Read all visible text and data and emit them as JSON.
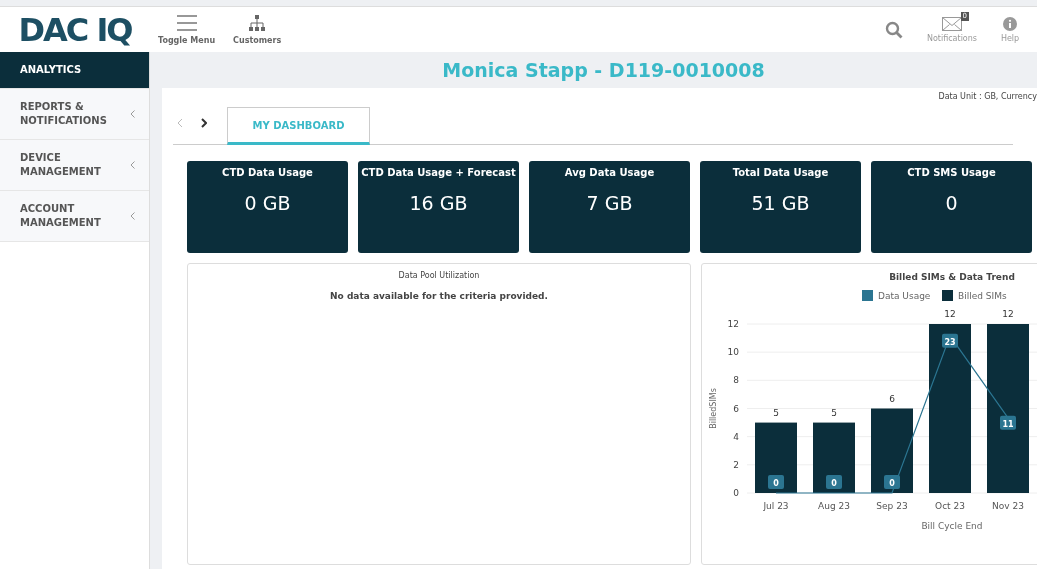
{
  "header": {
    "logo": "DAC IQ",
    "tools": [
      {
        "label": "Toggle Menu",
        "kind": "menu"
      },
      {
        "label": "Customers",
        "kind": "hierarchy"
      }
    ],
    "actions": [
      {
        "kind": "search"
      },
      {
        "kind": "mail",
        "label": "Notifications",
        "badge": "0"
      },
      {
        "kind": "info",
        "label": "Help"
      }
    ]
  },
  "sidebar": {
    "items": [
      {
        "label": "ANALYTICS",
        "selected": true,
        "has_submenu": false
      },
      {
        "label": "REPORTS & NOTIFICATIONS",
        "selected": false,
        "has_submenu": true
      },
      {
        "label": "DEVICE MANAGEMENT",
        "selected": false,
        "has_submenu": true
      },
      {
        "label": "ACCOUNT MANAGEMENT",
        "selected": false,
        "has_submenu": true
      }
    ]
  },
  "page_title": "Monica Stapp - D119-0010008",
  "data_unit": "Data Unit : GB, Currency",
  "pager": {
    "prev_disabled": true,
    "next_disabled": false
  },
  "tabs": [
    {
      "label": "MY DASHBOARD",
      "selected": true
    }
  ],
  "kpis": [
    {
      "title": "CTD Data Usage",
      "value": "0 GB"
    },
    {
      "title": "CTD Data Usage + Forecast",
      "value": "16 GB"
    },
    {
      "title": "Avg Data Usage",
      "value": "7 GB"
    },
    {
      "title": "Total Data Usage",
      "value": "51 GB"
    },
    {
      "title": "CTD SMS Usage",
      "value": "0"
    }
  ],
  "pool_panel": {
    "title": "Data Pool Utilization",
    "message": "No data available for the criteria provided."
  },
  "trend_panel": {
    "chart_data": {
      "type": "bar",
      "title": "Billed SIMs & Data Trend",
      "xlabel": "Bill Cycle End",
      "ylabel": "BilledSIMs",
      "categories": [
        "Jul 23",
        "Aug 23",
        "Sep 23",
        "Oct 23",
        "Nov 23"
      ],
      "series": [
        {
          "name": "Data Usage",
          "color": "#2b7591",
          "type": "line",
          "axis": "y2",
          "values": [
            0,
            0,
            0,
            23,
            11
          ]
        },
        {
          "name": "Billed SIMs",
          "color": "#0b2e3b",
          "values": [
            5,
            5,
            6,
            12,
            12
          ]
        }
      ],
      "ylim": [
        0,
        12
      ],
      "grid": true,
      "legend": "top",
      "yticks": [
        0,
        2,
        4,
        6,
        8,
        10,
        12
      ],
      "data_labels": true
    }
  }
}
